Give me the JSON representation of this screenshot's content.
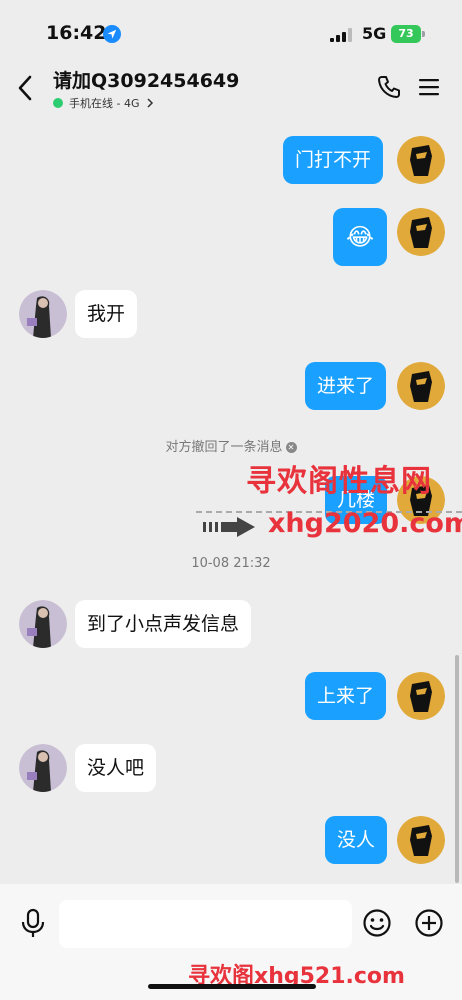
{
  "status_bar": {
    "time": "16:42",
    "network": "5G",
    "battery": "73"
  },
  "header": {
    "contact_name": "请加Q3092454649",
    "presence": "手机在线 - 4G"
  },
  "colors": {
    "outgoing_bubble": "#1aa0ff",
    "incoming_bubble": "#ffffff",
    "background": "#ededed",
    "online": "#2ecc71",
    "watermark": "#e8323c"
  },
  "messages": [
    {
      "sender": "me",
      "text": "门打不开"
    },
    {
      "sender": "me",
      "text": "😂"
    },
    {
      "sender": "other",
      "text": "我开"
    },
    {
      "sender": "me",
      "text": "进来了"
    },
    {
      "sender": "me",
      "text": "几楼"
    },
    {
      "sender": "other",
      "text": "到了小点声发信息"
    },
    {
      "sender": "me",
      "text": "上来了"
    },
    {
      "sender": "other",
      "text": "没人吧"
    },
    {
      "sender": "me",
      "text": "没人"
    }
  ],
  "recall_notice": "对方撤回了一条消息",
  "timestamp": "10-08 21:32",
  "watermark": {
    "title": "寻欢阁性息网",
    "url": "xhg2020.com",
    "bottom": "寻欢阁xhg521.com"
  },
  "input": {
    "placeholder": ""
  },
  "icons": [
    "location-arrow-icon",
    "signal-icon",
    "battery-icon",
    "back-chevron-icon",
    "phone-icon",
    "menu-icon",
    "microphone-icon",
    "emoji-icon",
    "plus-icon"
  ]
}
